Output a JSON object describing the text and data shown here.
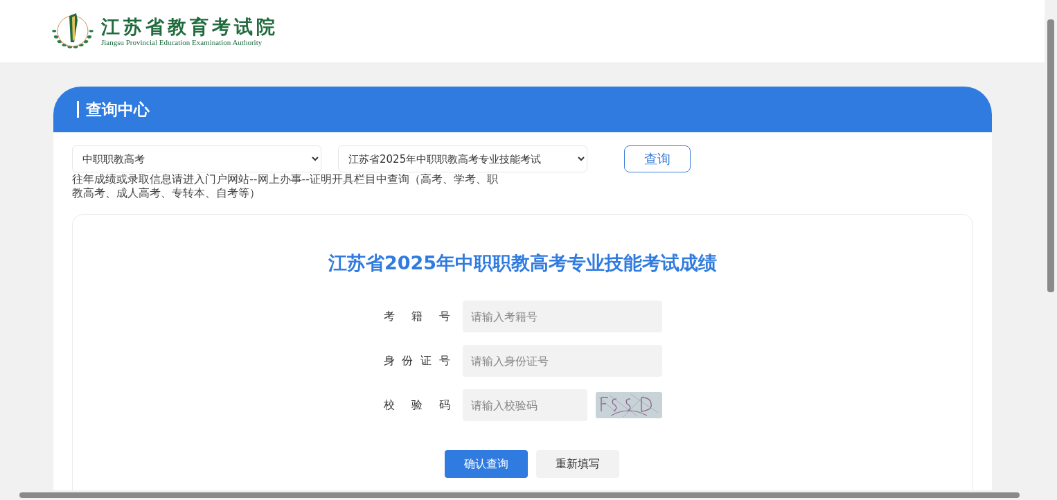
{
  "header": {
    "logo_title": "江苏省教育考试院",
    "logo_subtitle": "Jiangsu Provincial Education Examination Authority"
  },
  "panel": {
    "title": "查询中心",
    "filters": [
      {
        "value": "中职职教高考"
      },
      {
        "value": "江苏省2025年中职职教高考专业技能考试"
      }
    ],
    "query_button": "查询",
    "notice": "往年成绩或录取信息请进入门户网站--网上办事--证明开具栏目中查询（高考、学考、职教高考、成人高考、专转本、自考等）",
    "form": {
      "title": "江苏省2025年中职职教高考专业技能考试成绩",
      "fields": [
        {
          "kind": "text",
          "label": "考籍号",
          "placeholder": "请输入考籍号"
        },
        {
          "kind": "text",
          "label": "身份证号",
          "placeholder": "请输入身份证号"
        },
        {
          "kind": "captcha",
          "label": "校验码",
          "placeholder": "请输入校验码"
        }
      ],
      "buttons": [
        {
          "label": "确认查询",
          "kind": "primary"
        },
        {
          "label": "重新填写",
          "kind": "secondary"
        }
      ]
    }
  }
}
